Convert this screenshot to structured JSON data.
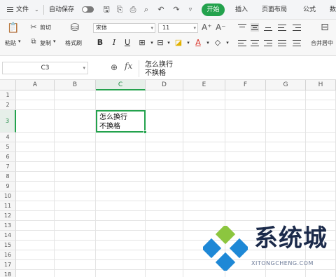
{
  "menubar": {
    "file": "文件",
    "autosave": "自动保存",
    "tabs": [
      "开始",
      "插入",
      "页面布局",
      "公式",
      "数"
    ]
  },
  "ribbon": {
    "paste": "粘贴",
    "cut": "剪切",
    "copy": "复制",
    "format_painter": "格式刷",
    "font_name": "宋体",
    "font_size": "11",
    "merge": "合并居中"
  },
  "formula_bar": {
    "cell_ref": "C3",
    "content_line1": "怎么换行",
    "content_line2": "不换格"
  },
  "grid": {
    "columns": [
      "A",
      "B",
      "C",
      "D",
      "E",
      "F",
      "G",
      "H"
    ],
    "rows": [
      "1",
      "2",
      "3",
      "4",
      "5",
      "6",
      "7",
      "8",
      "9",
      "10",
      "11",
      "12",
      "13",
      "14",
      "15",
      "16",
      "17",
      "18"
    ],
    "active_column": "C",
    "active_row": "3",
    "active_cell_line1": "怎么换行",
    "active_cell_line2": "不换格"
  },
  "watermark": {
    "title": "系统城",
    "subtitle": "XITONGCHENG.COM"
  },
  "colors": {
    "accent": "#23a24d",
    "watermark_text": "#1b2a4a"
  }
}
